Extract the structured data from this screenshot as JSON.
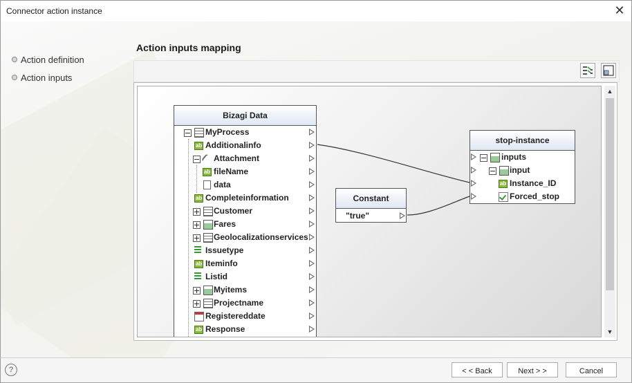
{
  "window": {
    "title": "Connector action instance",
    "close_glyph": "✕"
  },
  "nav": {
    "items": [
      {
        "label": "Action definition"
      },
      {
        "label": "Action inputs"
      }
    ]
  },
  "heading": "Action inputs mapping",
  "toolbar": {
    "buttons": [
      {
        "icon": "auto-map-icon"
      },
      {
        "icon": "fit-view-icon"
      }
    ]
  },
  "source": {
    "title": "Bizagi Data",
    "rows": [
      {
        "label": "MyProcess",
        "icon": "table-icon"
      },
      {
        "label": "Additionalinfo",
        "icon": "text-attribute-icon"
      },
      {
        "label": "Attachment",
        "icon": "attachment-icon"
      },
      {
        "label": "fileName",
        "icon": "text-attribute-icon"
      },
      {
        "label": "data",
        "icon": "file-icon"
      },
      {
        "label": "Completeinformation",
        "icon": "text-attribute-icon"
      },
      {
        "label": "Customer",
        "icon": "table-icon"
      },
      {
        "label": "Fares",
        "icon": "collection-icon"
      },
      {
        "label": "Geolocalizationservices",
        "icon": "table-icon"
      },
      {
        "label": "Issuetype",
        "icon": "list-icon"
      },
      {
        "label": "Iteminfo",
        "icon": "text-attribute-icon"
      },
      {
        "label": "Listid",
        "icon": "list-icon"
      },
      {
        "label": "Myitems",
        "icon": "collection-icon"
      },
      {
        "label": "Projectname",
        "icon": "table-icon"
      },
      {
        "label": "Registereddate",
        "icon": "date-icon"
      },
      {
        "label": "Response",
        "icon": "text-attribute-icon"
      }
    ]
  },
  "constant": {
    "title": "Constant",
    "value": "\"true\""
  },
  "target": {
    "title": "stop-instance",
    "rows": [
      {
        "label": "inputs",
        "icon": "group-icon"
      },
      {
        "label": "input",
        "icon": "group-icon"
      },
      {
        "label": "Instance_ID",
        "icon": "text-attribute-icon"
      },
      {
        "label": "Forced_stop",
        "icon": "boolean-icon"
      }
    ]
  },
  "mappings": [
    {
      "from": "Additionalinfo",
      "to": "Instance_ID"
    },
    {
      "from": "Constant \"true\"",
      "to": "Instance_ID"
    }
  ],
  "footer": {
    "help": "?",
    "back": "< < Back",
    "next": "Next > >",
    "cancel": "Cancel"
  }
}
